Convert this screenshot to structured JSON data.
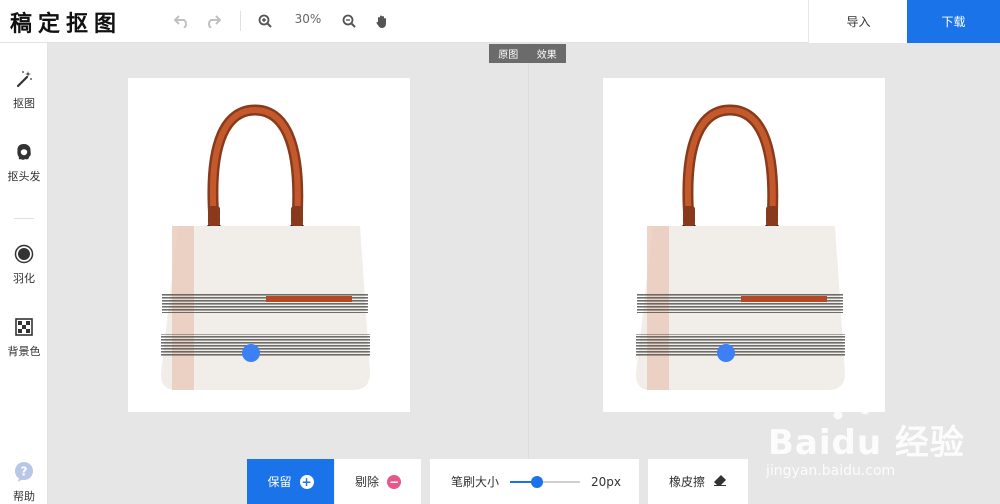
{
  "app": {
    "logo": "稿定抠图"
  },
  "toolbar": {
    "zoom": "30%",
    "import_label": "导入",
    "download_label": "下载"
  },
  "sidebar": {
    "items": [
      {
        "label": "抠图",
        "icon": "magic-wand-icon"
      },
      {
        "label": "抠头发",
        "icon": "hair-icon"
      },
      {
        "label": "羽化",
        "icon": "feather-icon"
      },
      {
        "label": "背景色",
        "icon": "background-color-icon"
      }
    ],
    "help_label": "帮助"
  },
  "view_tabs": {
    "original": "原图",
    "effect": "效果"
  },
  "bottom": {
    "keep_label": "保留",
    "remove_label": "剔除",
    "brush_label": "笔刷大小",
    "brush_value": "20px",
    "brush_fraction": 0.38,
    "eraser_label": "橡皮擦"
  },
  "colors": {
    "accent": "#1a73e8",
    "keep_dot": "#3d7ff5",
    "remove_icon": "#e8578a"
  },
  "watermark": {
    "main": "Baidu 经验",
    "sub": "jingyan.baidu.com"
  }
}
